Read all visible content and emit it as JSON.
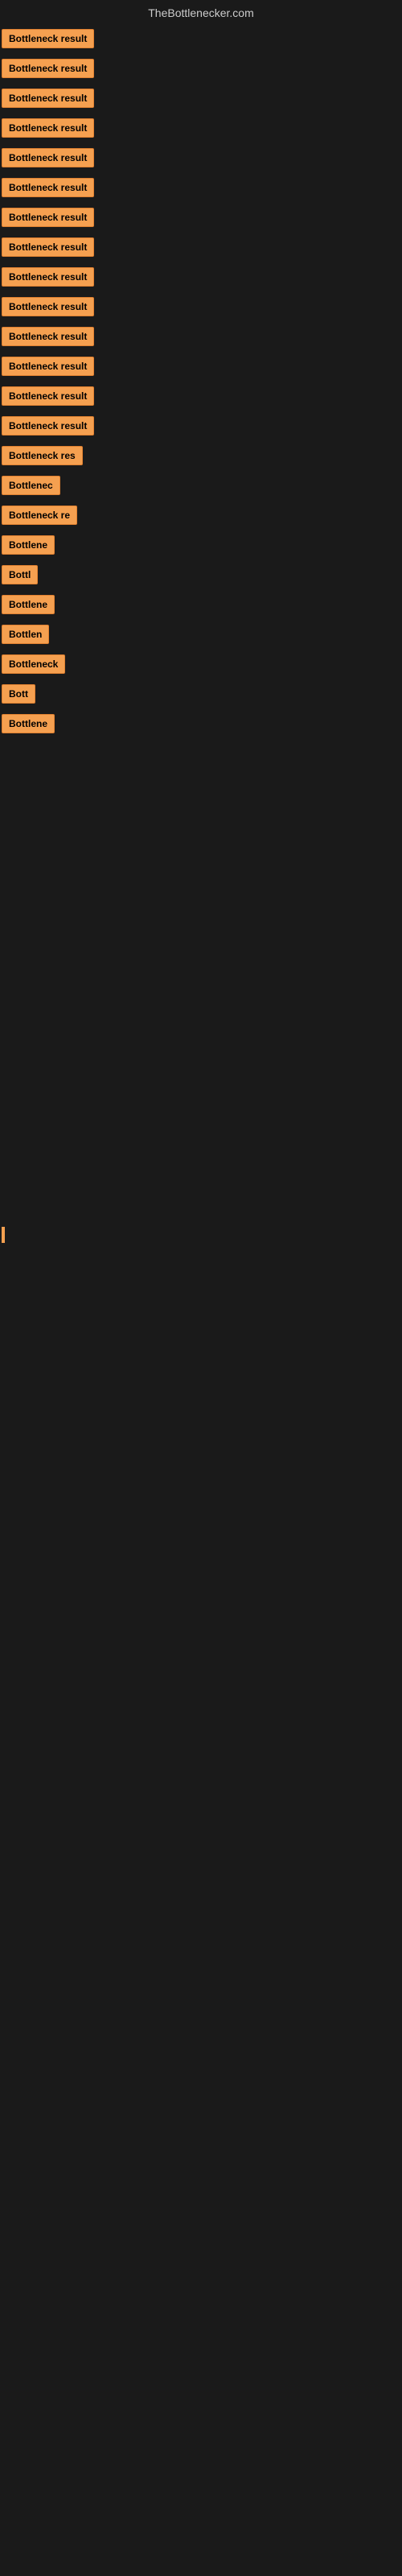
{
  "header": {
    "title": "TheBottlenecker.com"
  },
  "items": [
    {
      "label": "Bottleneck result",
      "width": 130
    },
    {
      "label": "Bottleneck result",
      "width": 130
    },
    {
      "label": "Bottleneck result",
      "width": 130
    },
    {
      "label": "Bottleneck result",
      "width": 130
    },
    {
      "label": "Bottleneck result",
      "width": 130
    },
    {
      "label": "Bottleneck result",
      "width": 130
    },
    {
      "label": "Bottleneck result",
      "width": 130
    },
    {
      "label": "Bottleneck result",
      "width": 130
    },
    {
      "label": "Bottleneck result",
      "width": 130
    },
    {
      "label": "Bottleneck result",
      "width": 130
    },
    {
      "label": "Bottleneck result",
      "width": 130
    },
    {
      "label": "Bottleneck result",
      "width": 130
    },
    {
      "label": "Bottleneck result",
      "width": 130
    },
    {
      "label": "Bottleneck result",
      "width": 130
    },
    {
      "label": "Bottleneck res",
      "width": 110
    },
    {
      "label": "Bottlenec",
      "width": 80
    },
    {
      "label": "Bottleneck re",
      "width": 100
    },
    {
      "label": "Bottlene",
      "width": 75
    },
    {
      "label": "Bottl",
      "width": 50
    },
    {
      "label": "Bottlene",
      "width": 75
    },
    {
      "label": "Bottlen",
      "width": 65
    },
    {
      "label": "Bottleneck",
      "width": 85
    },
    {
      "label": "Bott",
      "width": 42
    },
    {
      "label": "Bottlene",
      "width": 75
    }
  ],
  "accent_color": "#f5a050",
  "bg_color": "#1a1a1a"
}
